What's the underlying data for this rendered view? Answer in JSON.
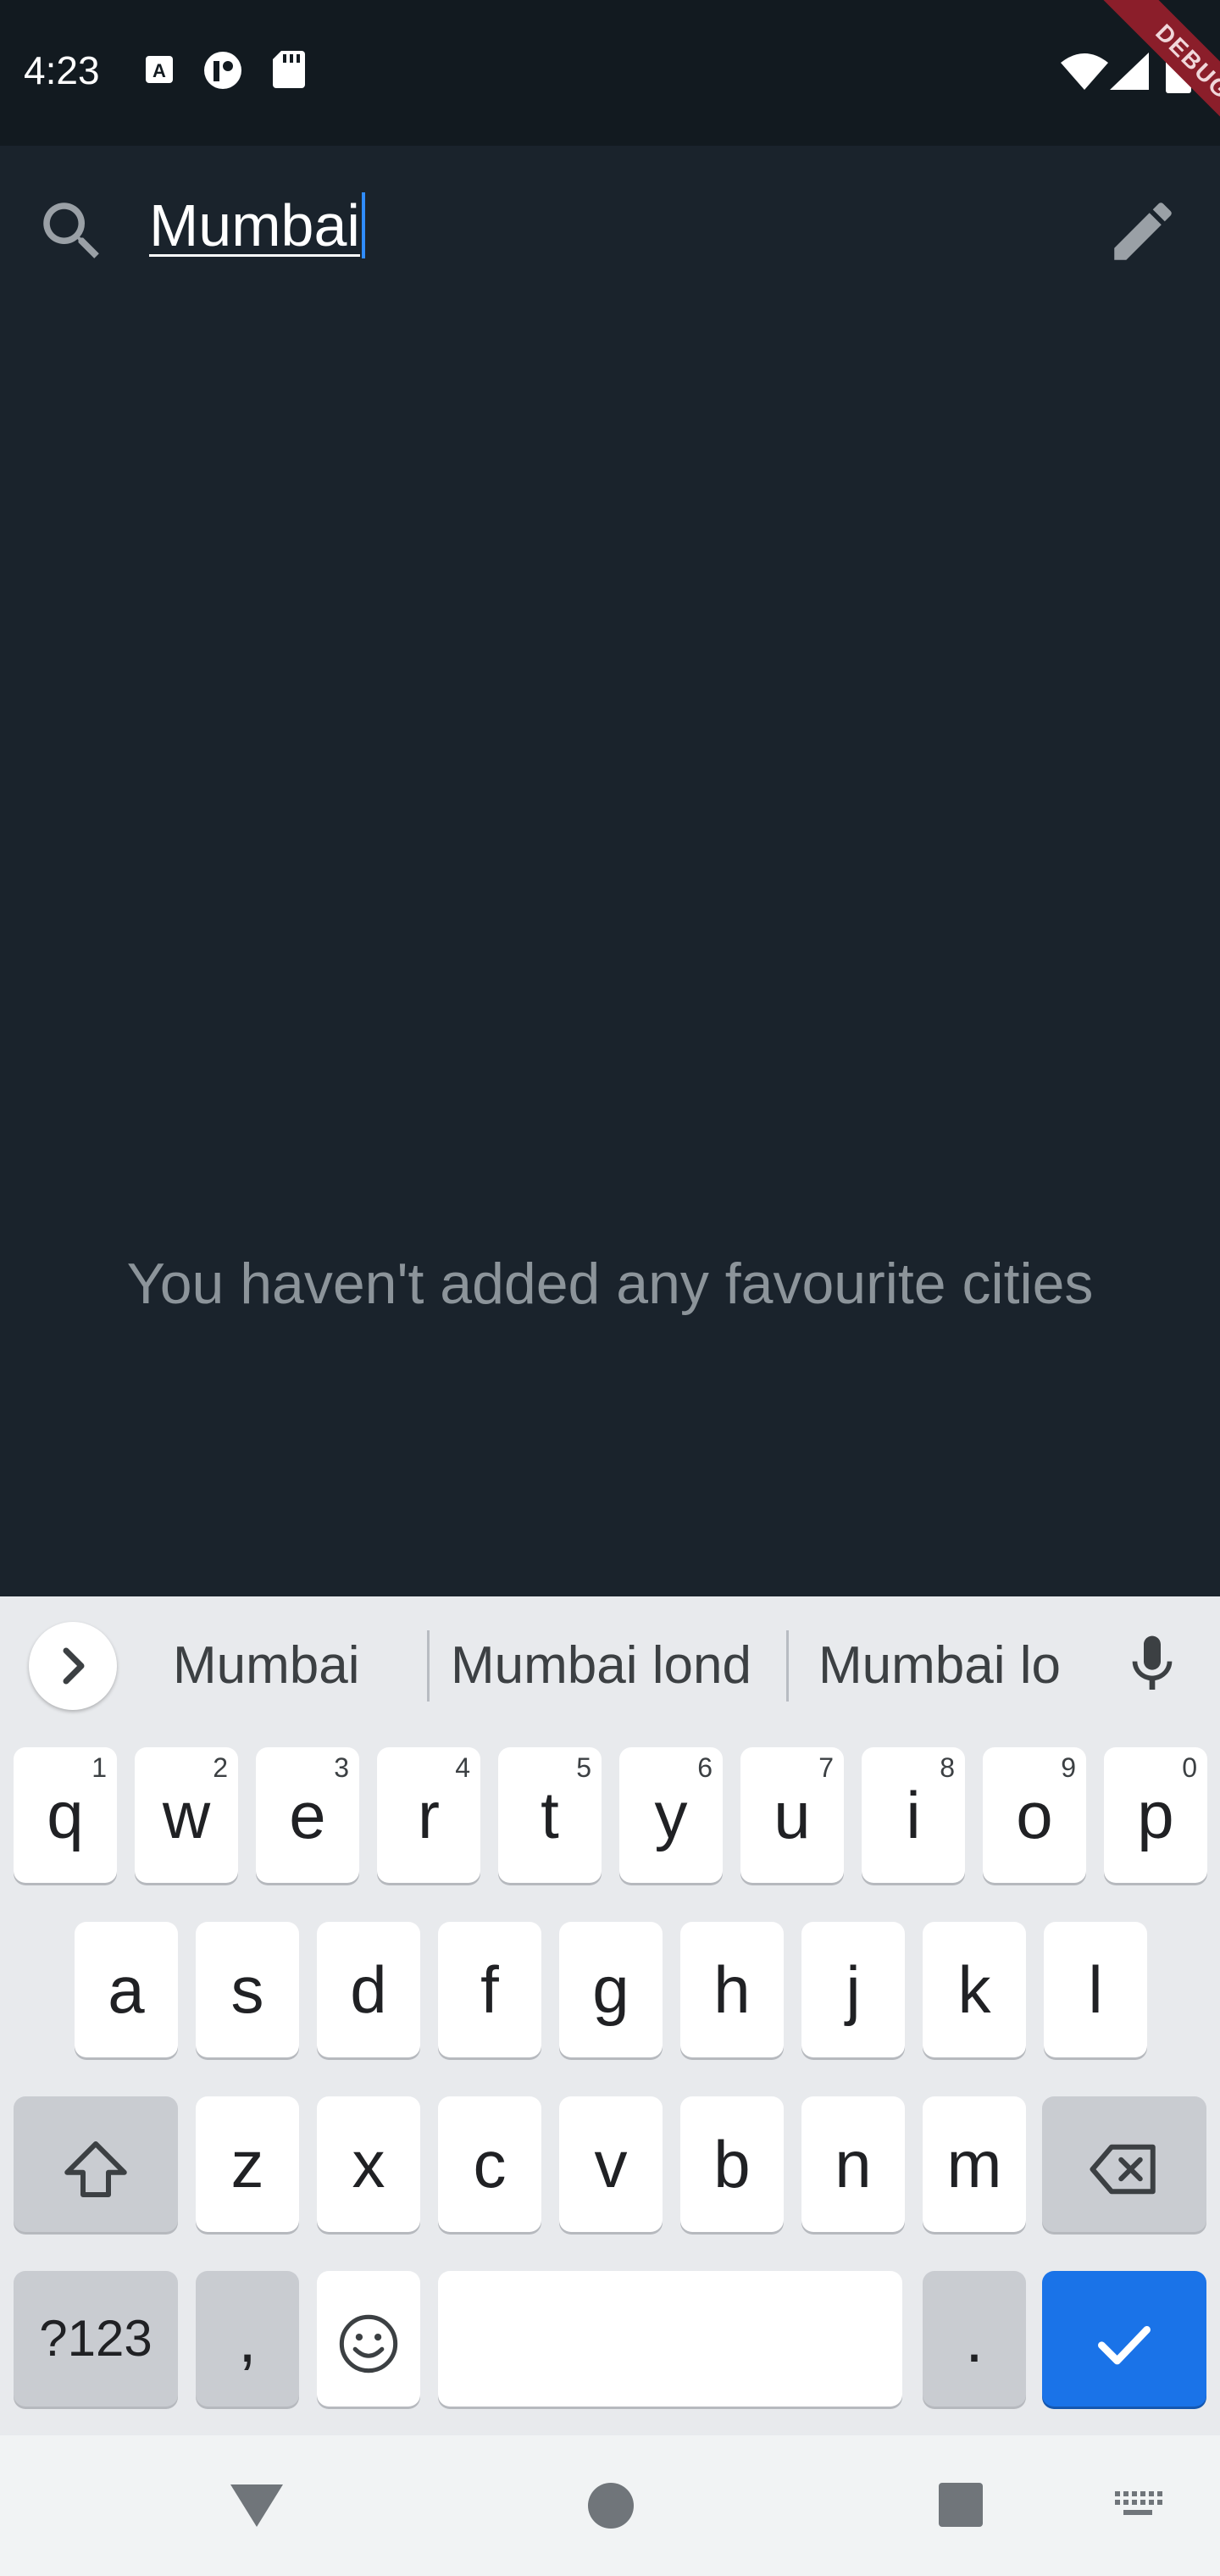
{
  "status_bar": {
    "time": "4:23"
  },
  "debug_banner": "DEBUG",
  "search": {
    "value": "Mumbai"
  },
  "empty_state": "You haven't added any favourite cities",
  "suggestions": [
    "Mumbai",
    "Mumbai lond",
    "Mumbai lo"
  ],
  "keyboard": {
    "row1": [
      {
        "l": "q",
        "h": "1"
      },
      {
        "l": "w",
        "h": "2"
      },
      {
        "l": "e",
        "h": "3"
      },
      {
        "l": "r",
        "h": "4"
      },
      {
        "l": "t",
        "h": "5"
      },
      {
        "l": "y",
        "h": "6"
      },
      {
        "l": "u",
        "h": "7"
      },
      {
        "l": "i",
        "h": "8"
      },
      {
        "l": "o",
        "h": "9"
      },
      {
        "l": "p",
        "h": "0"
      }
    ],
    "row2": [
      "a",
      "s",
      "d",
      "f",
      "g",
      "h",
      "j",
      "k",
      "l"
    ],
    "row3": [
      "z",
      "x",
      "c",
      "v",
      "b",
      "n",
      "m"
    ],
    "symbols_key": "?123",
    "comma_key": ",",
    "period_key": "."
  },
  "colors": {
    "background": "#1a232c",
    "accent": "#1a73e8",
    "caret": "#2f8cff"
  }
}
